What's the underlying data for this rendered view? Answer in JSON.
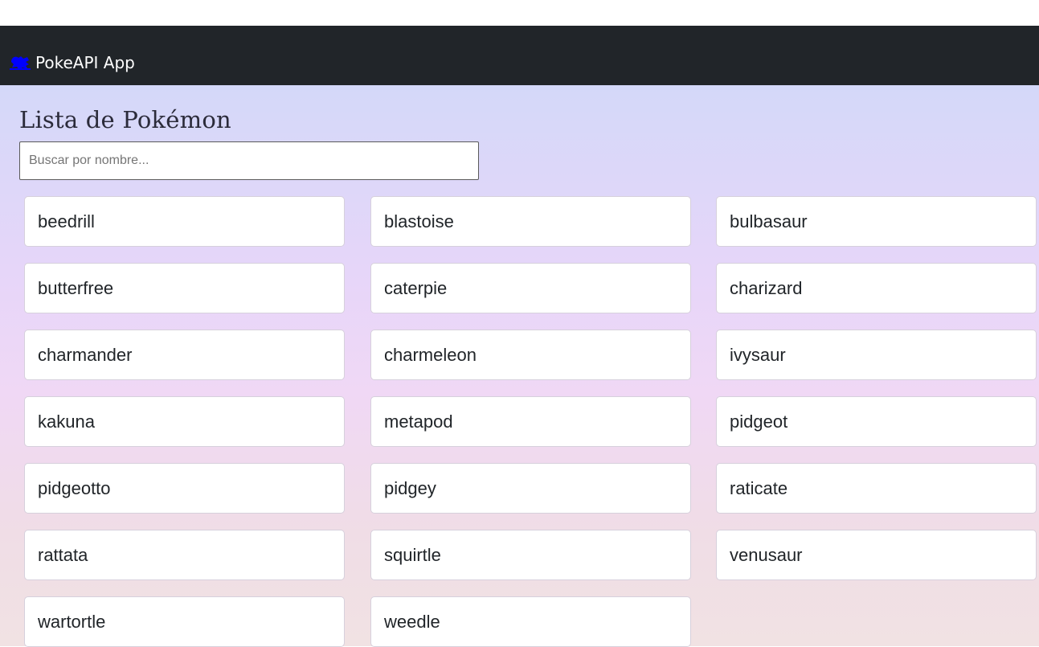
{
  "navbar": {
    "brand_label": "PokeAPI App",
    "brand_icon": "pokemon-logo-icon"
  },
  "main": {
    "title": "Lista de Pokémon",
    "search": {
      "placeholder": "Buscar por nombre...",
      "value": ""
    },
    "pokemon": [
      "beedrill",
      "blastoise",
      "bulbasaur",
      "butterfree",
      "caterpie",
      "charizard",
      "charmander",
      "charmeleon",
      "ivysaur",
      "kakuna",
      "metapod",
      "pidgeot",
      "pidgeotto",
      "pidgey",
      "raticate",
      "rattata",
      "squirtle",
      "venusaur",
      "wartortle",
      "weedle"
    ]
  },
  "colors": {
    "navbar_bg": "#212529",
    "brand_icon": "#0000ff",
    "card_bg": "#ffffff",
    "gradient_top": "#d4d8f9",
    "gradient_bottom": "#f1e2e3"
  }
}
